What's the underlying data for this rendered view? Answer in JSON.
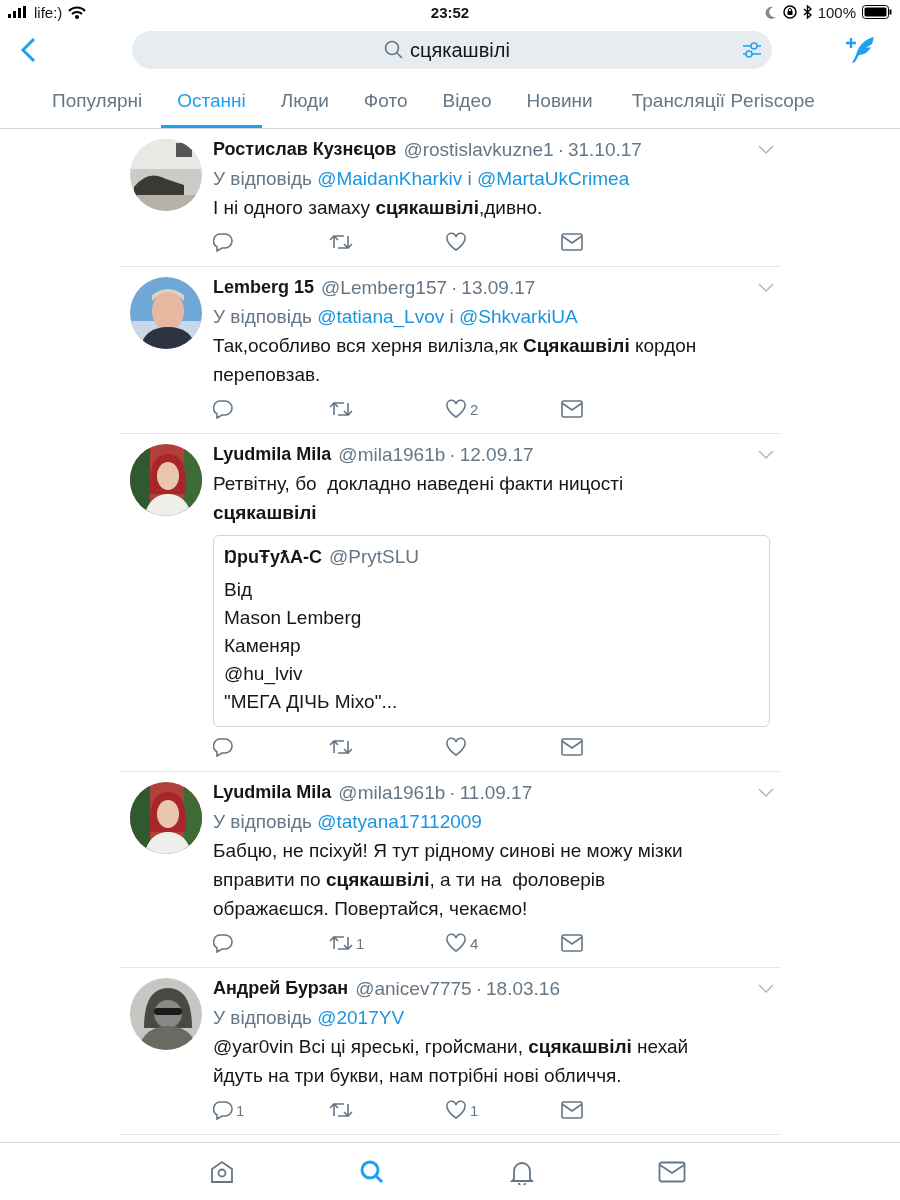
{
  "status_bar": {
    "carrier": "life:)",
    "time": "23:52",
    "battery": "100%"
  },
  "search": {
    "value": "сцякашвілі"
  },
  "tabs": [
    {
      "label": "Популярні",
      "selected": false
    },
    {
      "label": "Останні",
      "selected": true
    },
    {
      "label": "Люди",
      "selected": false
    },
    {
      "label": "Фото",
      "selected": false
    },
    {
      "label": "Відео",
      "selected": false
    },
    {
      "label": "Новини",
      "selected": false
    },
    {
      "label": "Трансляції Periscope",
      "selected": false
    }
  ],
  "separator": "·",
  "tweets": [
    {
      "name": "Ростислав Кузнєцов",
      "handle": "@rostislavkuzne1",
      "date": "31.10.17",
      "reply": {
        "label": "У відповідь",
        "mentions": [
          "@MaidanKharkiv",
          "@MartaUkCrimea"
        ],
        "joiner": "і"
      },
      "text": "І ні одного замаху **сцякашвілі**,дивно."
    },
    {
      "name": "Lemberg 15",
      "handle": "@Lemberg157",
      "date": "13.09.17",
      "reply": {
        "label": "У відповідь",
        "mentions": [
          "@tatiana_Lvov",
          "@ShkvarkiUA"
        ],
        "joiner": "і"
      },
      "text": "Так,особливо вся херня вилізла,як **Сцякашвілі** кордон переповзав.",
      "actions": {
        "likes": "2"
      }
    },
    {
      "name": "Lyudmila Mila",
      "handle": "@mila1961b",
      "date": "12.09.17",
      "text": "Ретвітну, бо  докладно наведені факти ницості **сцякашвілі**",
      "quote": {
        "name": "ŊpuŦyƛA-C",
        "handle": "@PrytSLU",
        "lines": [
          "Від",
          "Mason Lemberg",
          "Каменяр",
          "@hu_lviv",
          "\"МЕГА ДІЧЬ Міхо\"..."
        ]
      }
    },
    {
      "name": "Lyudmila Mila",
      "handle": "@mila1961b",
      "date": "11.09.17",
      "reply": {
        "label": "У відповідь",
        "mentions": [
          "@tatyana17112009"
        ]
      },
      "text": "Бабцю, не псіхуй! Я тут рідному синові не можу мізки вправити по **сцякашвілі**, а ти на  фоловерів ображаєшся. Повертайся, чекаємо!",
      "actions": {
        "retweets": "1",
        "likes": "4"
      }
    },
    {
      "name": "Андрей Бурзан",
      "handle": "@anicev7775",
      "date": "18.03.16",
      "reply": {
        "label": "У відповідь",
        "mentions": [
          "@2017YV"
        ]
      },
      "text": "@yar0vin Всі ці яреські, гройсмани, **сцякашвілі** нехай йдуть на три букви, нам потрібні нові обличчя.",
      "actions": {
        "replies": "1",
        "likes": "1"
      }
    }
  ],
  "bottom_tabs": [
    {
      "kind": "home",
      "selected": false
    },
    {
      "kind": "search",
      "selected": true
    },
    {
      "kind": "notifications",
      "selected": false
    },
    {
      "kind": "messages",
      "selected": false
    }
  ]
}
